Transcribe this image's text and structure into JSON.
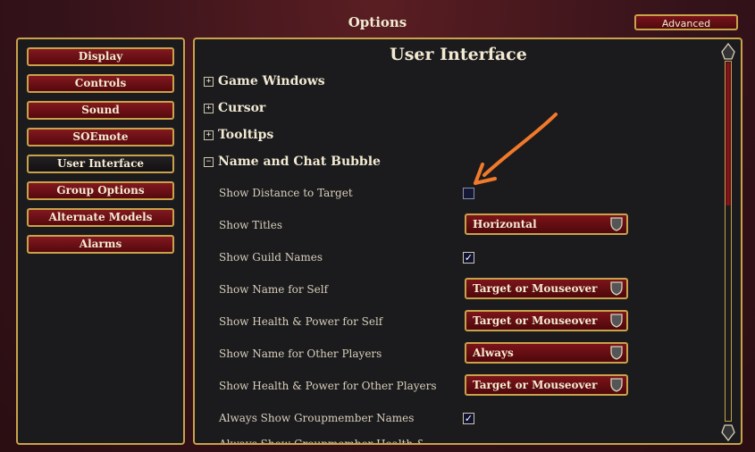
{
  "window": {
    "title": "Options",
    "advanced_label": "Advanced"
  },
  "sidebar": {
    "items": [
      {
        "label": "Display"
      },
      {
        "label": "Controls"
      },
      {
        "label": "Sound"
      },
      {
        "label": "SOEmote"
      },
      {
        "label": "User Interface",
        "active": true
      },
      {
        "label": "Group Options"
      },
      {
        "label": "Alternate Models"
      },
      {
        "label": "Alarms"
      }
    ]
  },
  "main": {
    "title": "User Interface",
    "groups": [
      {
        "label": "Game Windows",
        "expanded": false
      },
      {
        "label": "Cursor",
        "expanded": false
      },
      {
        "label": "Tooltips",
        "expanded": false
      },
      {
        "label": "Name and Chat Bubble",
        "expanded": true
      }
    ],
    "options": [
      {
        "label": "Show Distance to Target",
        "type": "checkbox",
        "checked": false
      },
      {
        "label": "Show Titles",
        "type": "dropdown",
        "value": "Horizontal"
      },
      {
        "label": "Show Guild Names",
        "type": "checkbox",
        "checked": true
      },
      {
        "label": "Show Name for Self",
        "type": "dropdown",
        "value": "Target or Mouseover"
      },
      {
        "label": "Show Health & Power for Self",
        "type": "dropdown",
        "value": "Target or Mouseover"
      },
      {
        "label": "Show Name for Other Players",
        "type": "dropdown",
        "value": "Always"
      },
      {
        "label": "Show Health & Power for Other Players",
        "type": "dropdown",
        "value": "Target or Mouseover"
      },
      {
        "label": "Always Show Groupmember Names",
        "type": "checkbox",
        "checked": true
      },
      {
        "label": "Always Show Groupmember Health &",
        "type": "partial"
      }
    ],
    "check_glyph": "✓"
  },
  "colors": {
    "accent_gold": "#c9a24a",
    "button_red": "#821820",
    "annotation_arrow": "#f07a2a"
  }
}
